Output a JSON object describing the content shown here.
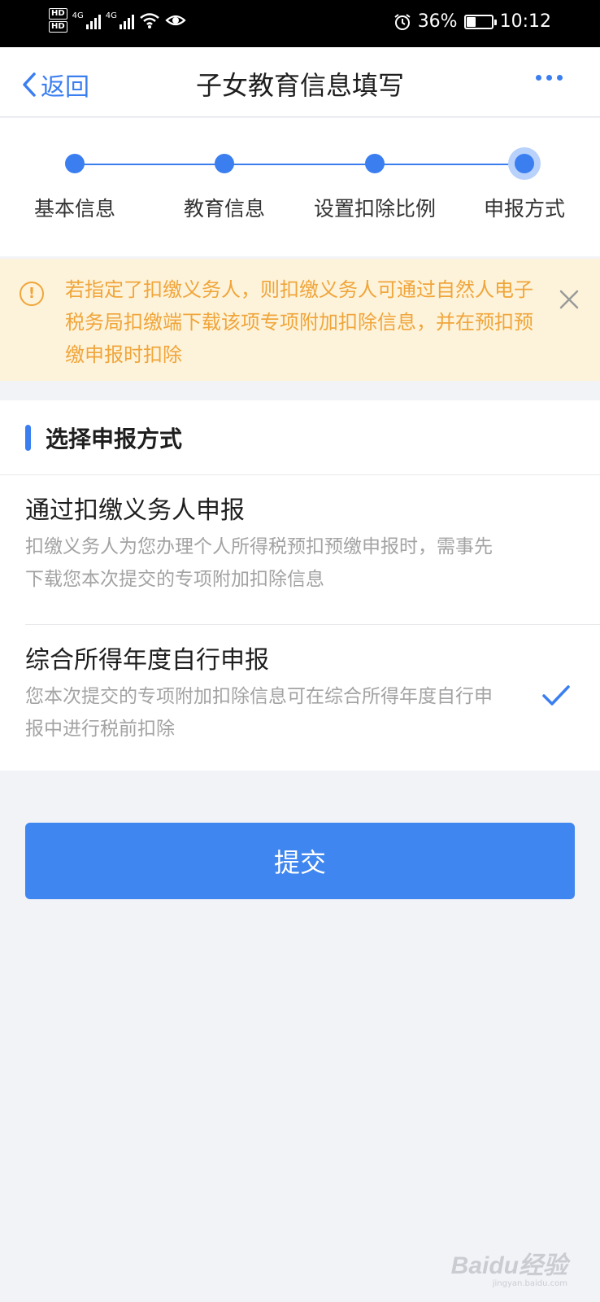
{
  "status_bar": {
    "hd1": "HD",
    "hd2": "HD",
    "net1": "4G",
    "net2": "4G",
    "battery_percent": "36%",
    "battery_level": 0.36,
    "time": "10:12",
    "icons": [
      "wifi-icon",
      "eye-icon",
      "alarm-icon",
      "battery-icon"
    ]
  },
  "nav": {
    "back_label": "返回",
    "title": "子女教育信息填写",
    "more_icon": "more-icon"
  },
  "stepper": {
    "steps": [
      {
        "label": "基本信息"
      },
      {
        "label": "教育信息"
      },
      {
        "label": "设置扣除比例"
      },
      {
        "label": "申报方式"
      }
    ],
    "current_index": 3
  },
  "notice": {
    "text": "若指定了扣缴义务人，则扣缴义务人可通过自然人电子税务局扣缴端下载该项专项附加扣除信息，并在预扣预缴申报时扣除"
  },
  "section": {
    "title": "选择申报方式",
    "options": [
      {
        "title": "通过扣缴义务人申报",
        "desc": "扣缴义务人为您办理个人所得税预扣预缴申报时，需事先下载您本次提交的专项附加扣除信息",
        "selected": false
      },
      {
        "title": "综合所得年度自行申报",
        "desc": "您本次提交的专项附加扣除信息可在综合所得年度自行申报中进行税前扣除",
        "selected": true
      }
    ]
  },
  "submit_label": "提交",
  "watermark": {
    "main": "Baidu经验",
    "sub": "jingyan.baidu.com"
  },
  "colors": {
    "accent": "#3a7ef0",
    "notice_bg": "#fdf3da",
    "notice_text": "#f0a53a",
    "page_bg": "#f2f3f7"
  }
}
